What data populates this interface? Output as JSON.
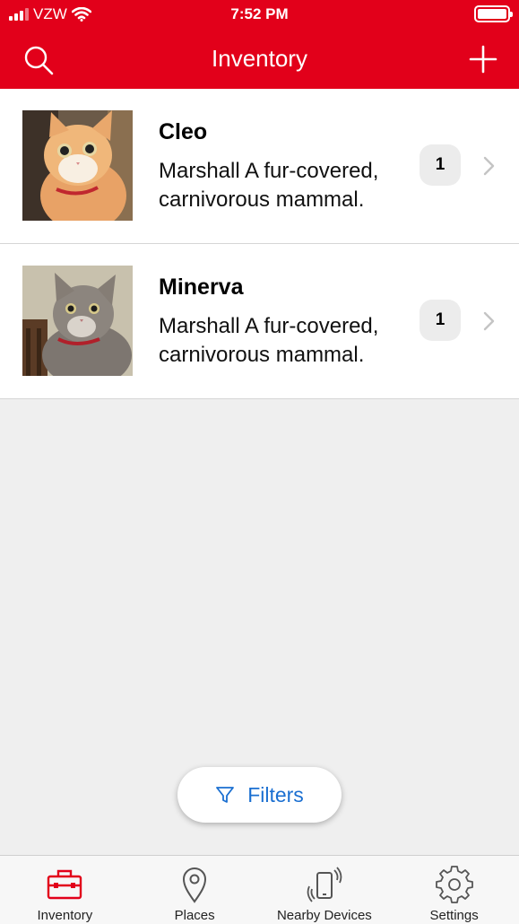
{
  "status_bar": {
    "carrier": "VZW",
    "time": "7:52 PM"
  },
  "header": {
    "title": "Inventory",
    "left_icon": "search-icon",
    "right_icon": "plus-icon",
    "background": "#e2001a"
  },
  "items": [
    {
      "name": "Cleo",
      "description": "Marshall A fur-covered, carnivorous mammal.",
      "count": "1",
      "image": "orange-tabby-cat-photo"
    },
    {
      "name": "Minerva",
      "description": "Marshall A fur-covered, carnivorous mammal.",
      "count": "1",
      "image": "gray-tabby-cat-photo"
    }
  ],
  "filters_button": {
    "label": "Filters",
    "icon": "filter-funnel-icon",
    "color": "#1a6fd1"
  },
  "tab_bar": {
    "active_color": "#e2001a",
    "tabs": [
      {
        "label": "Inventory",
        "icon": "toolbox-icon",
        "active": true
      },
      {
        "label": "Places",
        "icon": "location-pin-icon",
        "active": false
      },
      {
        "label": "Nearby Devices",
        "icon": "nearby-phone-icon",
        "active": false
      },
      {
        "label": "Settings",
        "icon": "gear-icon",
        "active": false
      }
    ]
  }
}
